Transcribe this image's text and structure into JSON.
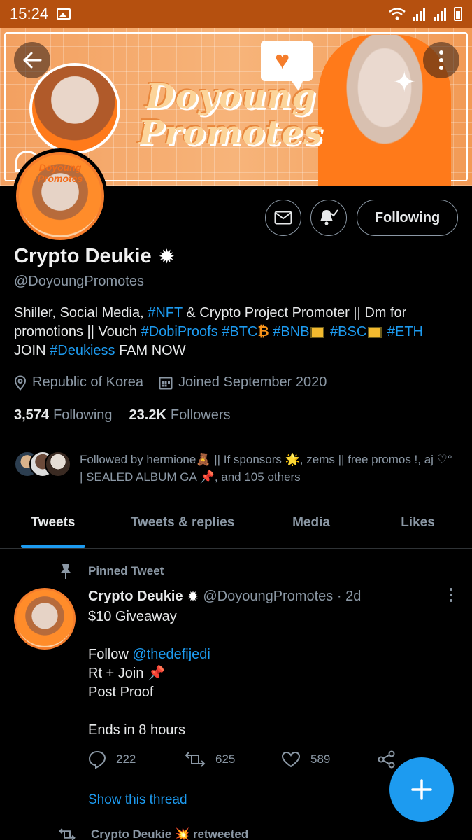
{
  "status_bar": {
    "time": "15:24"
  },
  "banner": {
    "title_line1": "Doyoung",
    "title_line2": "Promotes"
  },
  "avatar": {
    "label": "Doyoung Promotes"
  },
  "actions": {
    "following_label": "Following"
  },
  "profile": {
    "name": "Crypto Deukie",
    "handle": "@DoyoungPromotes",
    "bio": {
      "part1": "Shiller, Social Media, ",
      "tag_nft": "#NFT",
      "part2": " & Crypto Project Promoter || Dm for promotions || Vouch ",
      "tag_dobi": "#DobiProofs",
      "tag_btc": "#BTC",
      "btc_symbol": "₿",
      "tag_bnb": "#BNB",
      "tag_bsc": "#BSC",
      "tag_eth": "#ETH",
      "part3": "JOIN ",
      "tag_deukiess": "#Deukiess",
      "part4": " FAM NOW"
    },
    "location": "Republic of Korea",
    "joined": "Joined September 2020",
    "following_count": "3,574",
    "following_label": "Following",
    "followers_count": "23.2K",
    "followers_label": "Followers",
    "followed_by": "Followed by hermione🧸 || If sponsors 🌟, zems || free promos !, aj ♡° | SEALED ALBUM GA 📌, and 105 others"
  },
  "tabs": [
    {
      "label": "Tweets"
    },
    {
      "label": "Tweets & replies"
    },
    {
      "label": "Media"
    },
    {
      "label": "Likes"
    }
  ],
  "tweet": {
    "pinned_label": "Pinned Tweet",
    "author": "Crypto Deukie",
    "handle_time": "@DoyoungPromotes · 2d",
    "line1": "$10 Giveaway",
    "line2_prefix": "Follow ",
    "mention": "@thedefijedi",
    "line3": "Rt + Join 📌",
    "line4": "Post Proof",
    "line5": "Ends in 8 hours",
    "replies": "222",
    "retweets": "625",
    "likes": "589",
    "show_thread": "Show this thread"
  },
  "next_tweet": {
    "retweeted_label": "Crypto Deukie 💥 retweeted"
  },
  "colors": {
    "accent": "#1d9bf0",
    "status_bar": "#b5500f",
    "banner": "#f7b47a"
  }
}
